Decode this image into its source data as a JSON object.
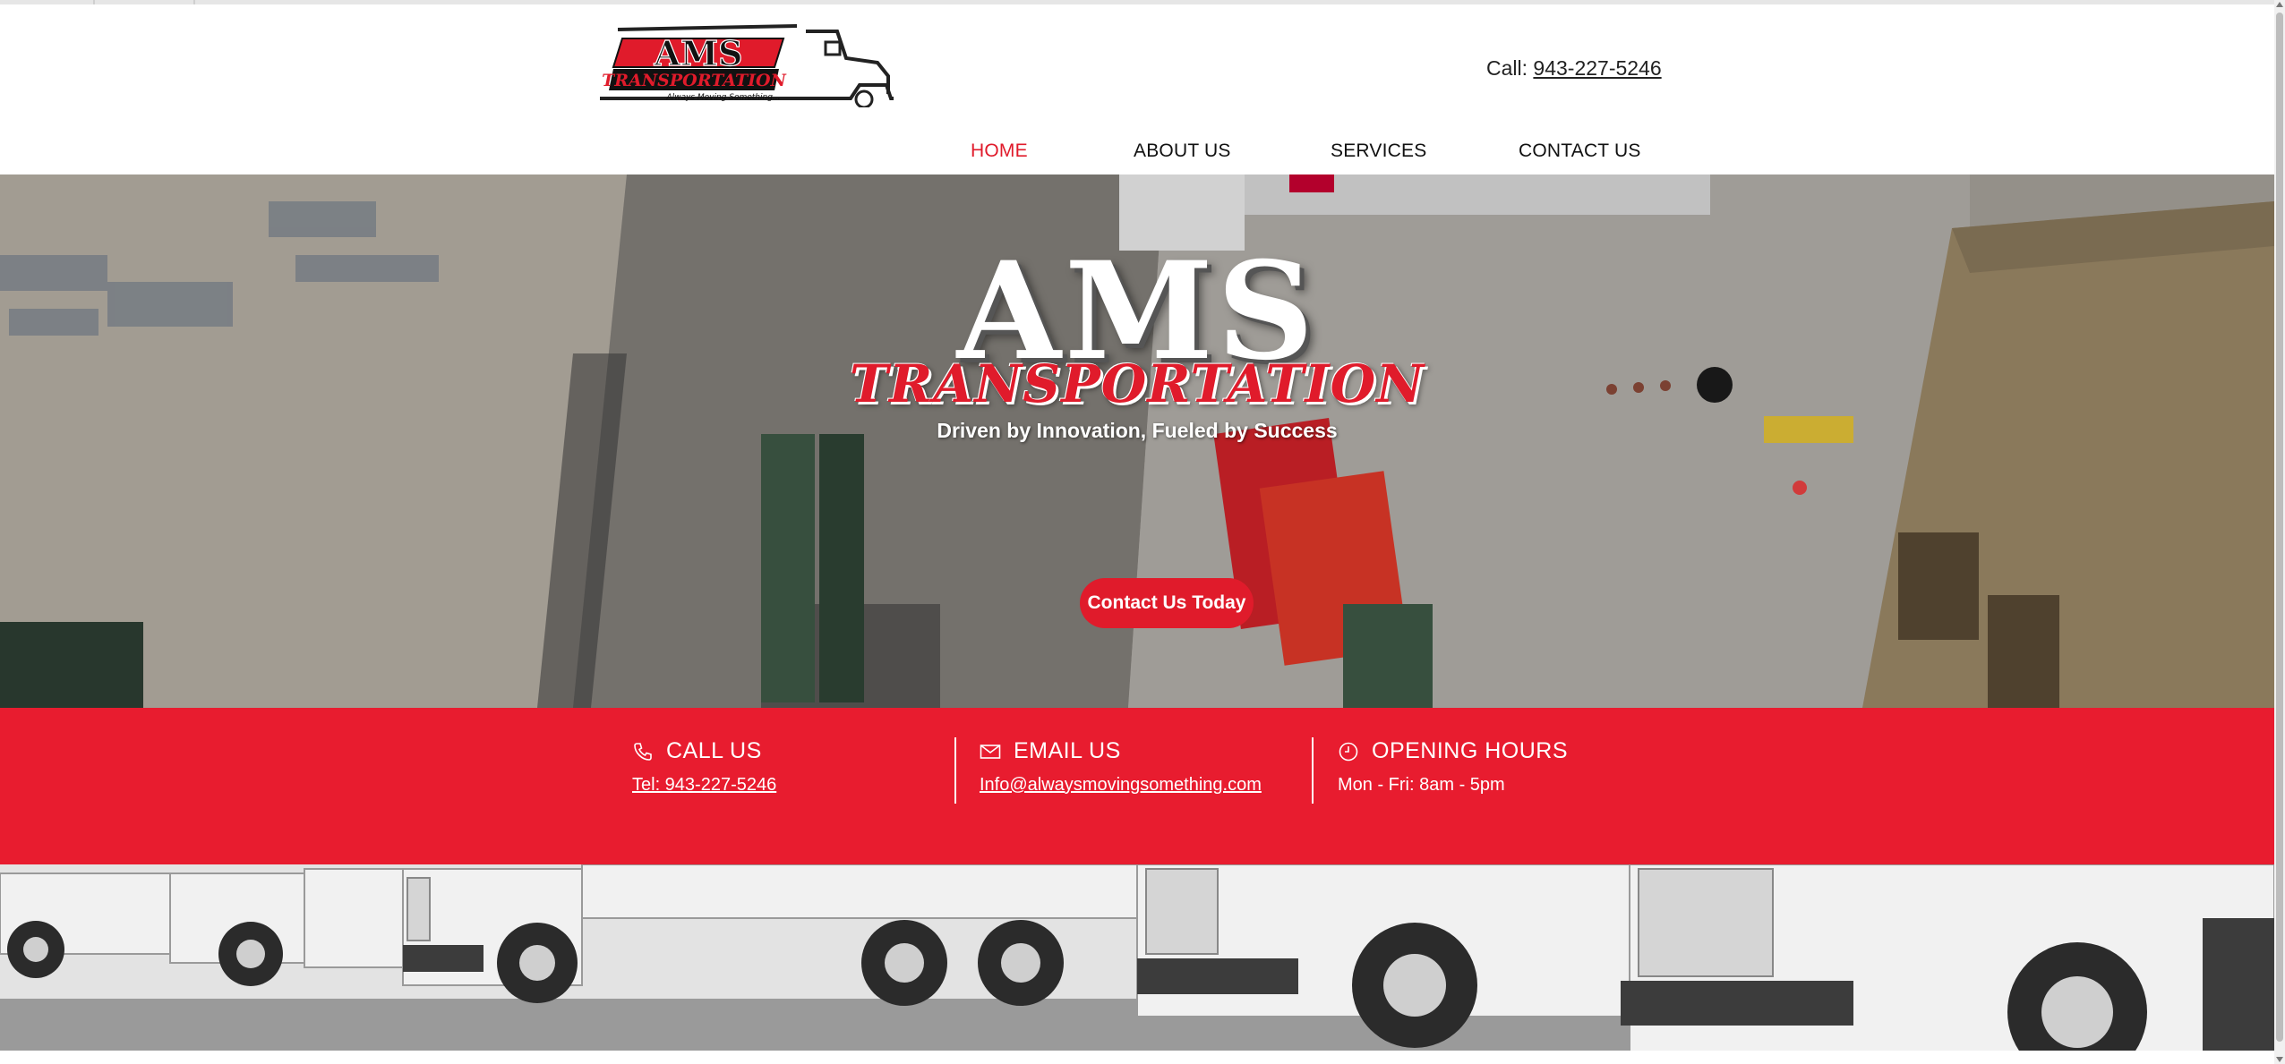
{
  "header": {
    "logo": {
      "main_text": "AMS",
      "sub_text": "TRANSPORTATION",
      "slogan": "Always Moving Something..."
    },
    "call_label": "Call:",
    "call_number": "943-227-5246"
  },
  "nav": {
    "items": [
      {
        "label": "HOME",
        "active": true
      },
      {
        "label": "ABOUT US",
        "active": false
      },
      {
        "label": "SERVICES",
        "active": false
      },
      {
        "label": "CONTACT US",
        "active": false
      }
    ]
  },
  "hero": {
    "title": "AMS",
    "subtitle": "TRANSPORTATION",
    "tagline": "Driven by Innovation, Fueled by Success",
    "cta_label": "Contact Us Today"
  },
  "info_band": {
    "call": {
      "heading": "CALL US",
      "value": "Tel: 943-227-5246",
      "icon": "phone-icon"
    },
    "email": {
      "heading": "EMAIL US",
      "value": "Info@alwaysmovingsomething.com",
      "icon": "mail-icon"
    },
    "hours": {
      "heading": "OPENING HOURS",
      "value": "Mon - Fri: 8am - 5pm",
      "icon": "clock-icon"
    }
  },
  "colors": {
    "accent": "#e01b2b",
    "band": "#e81c2f",
    "text": "#111111"
  }
}
